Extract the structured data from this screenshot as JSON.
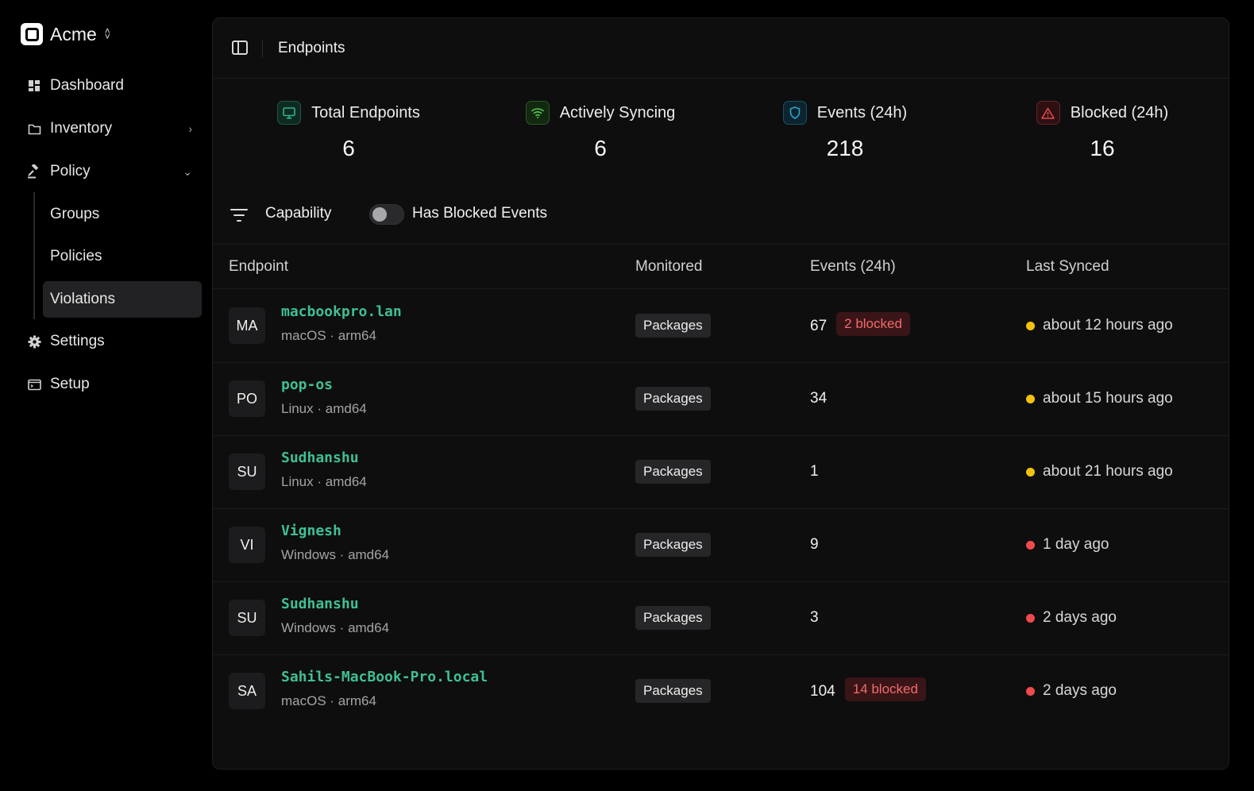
{
  "org": {
    "name": "Acme"
  },
  "nav": {
    "dashboard": "Dashboard",
    "inventory": "Inventory",
    "policy": "Policy",
    "groups": "Groups",
    "policies": "Policies",
    "violations": "Violations",
    "settings": "Settings",
    "setup": "Setup"
  },
  "header": {
    "breadcrumb": "Endpoints"
  },
  "stats": [
    {
      "label": "Total Endpoints",
      "value": "6",
      "icon": "monitor-icon",
      "color": "#2fb58a"
    },
    {
      "label": "Actively Syncing",
      "value": "6",
      "icon": "wifi-icon",
      "color": "#4cc24a"
    },
    {
      "label": "Events (24h)",
      "value": "218",
      "icon": "shield-icon",
      "color": "#2aa7c9"
    },
    {
      "label": "Blocked (24h)",
      "value": "16",
      "icon": "alert-triangle-icon",
      "color": "#e24a4a"
    }
  ],
  "filters": {
    "capability": "Capability",
    "toggle_label": "Has Blocked Events",
    "toggle_on": false
  },
  "table": {
    "columns": [
      "Endpoint",
      "Monitored",
      "Events (24h)",
      "Last Synced"
    ],
    "rows": [
      {
        "initials": "MA",
        "name": "macbookpro.lan",
        "meta": "macOS · arm64",
        "monitored": "Packages",
        "events": "67",
        "blocked": "2 blocked",
        "synced": "about 12 hours ago",
        "status": "#f4c20d"
      },
      {
        "initials": "PO",
        "name": "pop-os",
        "meta": "Linux · amd64",
        "monitored": "Packages",
        "events": "34",
        "blocked": "",
        "synced": "about 15 hours ago",
        "status": "#f4c20d"
      },
      {
        "initials": "SU",
        "name": "Sudhanshu",
        "meta": "Linux · amd64",
        "monitored": "Packages",
        "events": "1",
        "blocked": "",
        "synced": "about 21 hours ago",
        "status": "#f4c20d"
      },
      {
        "initials": "VI",
        "name": "Vignesh",
        "meta": "Windows · amd64",
        "monitored": "Packages",
        "events": "9",
        "blocked": "",
        "synced": "1 day ago",
        "status": "#ef4b4b"
      },
      {
        "initials": "SU",
        "name": "Sudhanshu",
        "meta": "Windows · amd64",
        "monitored": "Packages",
        "events": "3",
        "blocked": "",
        "synced": "2 days ago",
        "status": "#ef4b4b"
      },
      {
        "initials": "SA",
        "name": "Sahils-MacBook-Pro.local",
        "meta": "macOS · arm64",
        "monitored": "Packages",
        "events": "104",
        "blocked": "14 blocked",
        "synced": "2 days ago",
        "status": "#ef4b4b"
      }
    ]
  }
}
